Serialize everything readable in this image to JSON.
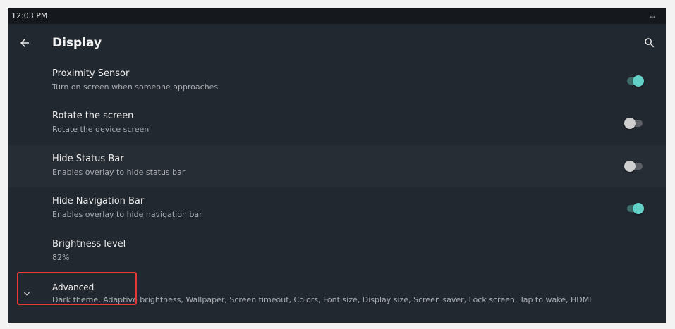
{
  "status_bar": {
    "time": "12:03 PM",
    "connection_icon": "swap-arrows-icon"
  },
  "toolbar": {
    "title": "Display",
    "back_icon": "arrow-back-icon",
    "search_icon": "search-icon"
  },
  "settings": [
    {
      "title": "Proximity Sensor",
      "subtitle": "Turn on screen when someone approaches",
      "toggle": true
    },
    {
      "title": "Rotate the screen",
      "subtitle": "Rotate the device screen",
      "toggle": false
    },
    {
      "title": "Hide Status Bar",
      "subtitle": "Enables overlay to hide status bar",
      "toggle": false
    },
    {
      "title": "Hide Navigation Bar",
      "subtitle": "Enables overlay to hide navigation bar",
      "toggle": true
    },
    {
      "title": "Brightness level",
      "subtitle": "82%"
    },
    {
      "title": "Advanced",
      "subtitle": "Dark theme, Adaptive brightness, Wallpaper, Screen timeout, Colors, Font size, Display size, Screen saver, Lock screen, Tap to wake, HDMI",
      "icon": "chevron-down-icon"
    }
  ],
  "colors": {
    "background": "#222830",
    "toggle_on": "#62d0c7",
    "toggle_off": "#cfcfcf",
    "highlight": "#e53935"
  }
}
